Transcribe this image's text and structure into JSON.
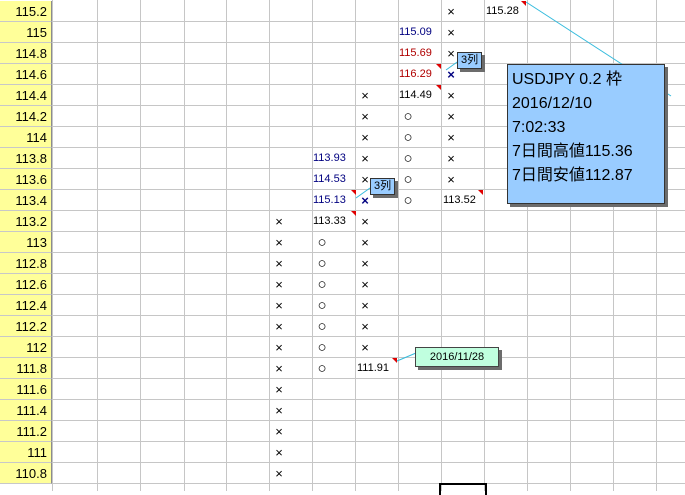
{
  "row_labels": [
    "115.2",
    "115",
    "114.8",
    "114.6",
    "114.4",
    "114.2",
    "114",
    "113.8",
    "113.6",
    "113.4",
    "113.2",
    "113",
    "112.8",
    "112.6",
    "112.4",
    "112.2",
    "112",
    "111.8",
    "111.6",
    "111.4",
    "111.2",
    "111",
    "110.8"
  ],
  "columns": [
    {
      "marks": {
        "10": "×",
        "11": "×",
        "12": "×",
        "13": "×",
        "14": "×",
        "15": "×",
        "16": "×",
        "17": "×",
        "18": "×",
        "19": "×",
        "20": "×",
        "21": "×",
        "22": "×"
      }
    },
    {
      "marks": {
        "11": "○",
        "12": "○",
        "13": "○",
        "14": "○",
        "15": "○",
        "16": "○",
        "17": "○"
      }
    },
    {
      "marks": {
        "4": "×",
        "5": "×",
        "6": "×",
        "7": "×",
        "8": "×",
        "9": "×",
        "10": "×",
        "11": "×",
        "12": "×",
        "13": "×",
        "14": "×",
        "15": "×",
        "16": "×"
      }
    },
    {
      "marks": {
        "5": "○",
        "6": "○",
        "7": "○",
        "8": "○",
        "9": "○"
      }
    },
    {
      "marks": {
        "0": "×",
        "1": "×",
        "2": "×",
        "3": "×",
        "4": "×",
        "5": "×",
        "6": "×",
        "7": "×",
        "8": "×"
      }
    }
  ],
  "cell_values": {
    "c_11533": "113.33",
    "c_11593": "113.93",
    "c_11453": "114.53",
    "c_11513": "115.13",
    "c_111_91": "111.91",
    "c_11509": "115.09",
    "c_11569": "115.69",
    "c_11629": "116.29",
    "c_11449": "114.49",
    "c_11352": "113.52",
    "c_11528": "115.28"
  },
  "notes": {
    "column_label_a": "3列",
    "column_label_b": "3列",
    "date_note": "2016/11/28",
    "summary": {
      "line1": "USDJPY 0.2 枠",
      "line2": "2016/12/10",
      "line3": "7:02:33",
      "line4": "7日間高値115.36",
      "line5": "7日間安値112.87"
    }
  },
  "colors": {
    "row_header_bg": "#ffff99",
    "note_bg": "#99ccff",
    "date_note_bg": "#c0ffdf",
    "rise_text": "#000080",
    "fall_text": "#b00000",
    "indicator": "#e00000",
    "leader_line": "#33bbdd"
  }
}
